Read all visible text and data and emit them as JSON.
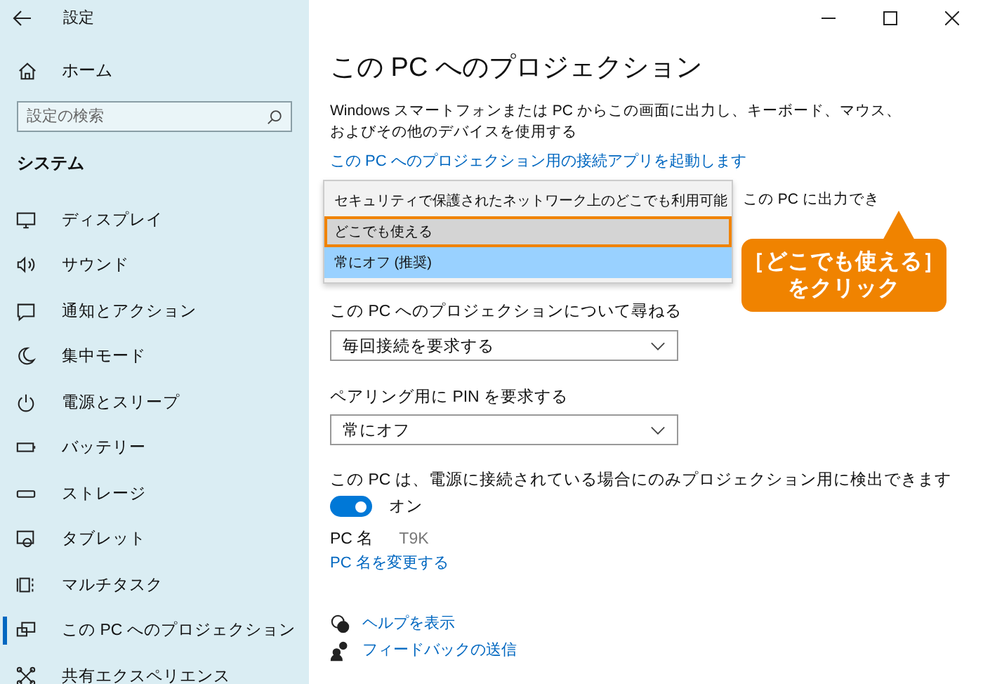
{
  "window": {
    "title": "設定"
  },
  "sidebar": {
    "home": "ホーム",
    "search": {
      "placeholder": "設定の検索"
    },
    "section": "システム",
    "items": [
      {
        "label": "ディスプレイ",
        "selected": false
      },
      {
        "label": "サウンド",
        "selected": false
      },
      {
        "label": "通知とアクション",
        "selected": false
      },
      {
        "label": "集中モード",
        "selected": false
      },
      {
        "label": "電源とスリープ",
        "selected": false
      },
      {
        "label": "バッテリー",
        "selected": false
      },
      {
        "label": "ストレージ",
        "selected": false
      },
      {
        "label": "タブレット",
        "selected": false
      },
      {
        "label": "マルチタスク",
        "selected": false
      },
      {
        "label": "この PC へのプロジェクション",
        "selected": true
      },
      {
        "label": "共有エクスペリエンス",
        "selected": false
      }
    ]
  },
  "page": {
    "title": "この PC へのプロジェクション",
    "description": "Windows スマートフォンまたは PC からこの画面に出力し、キーボード、マウス、およびその他のデバイスを使用する",
    "app_link": "この PC へのプロジェクション用の接続アプリを起動します",
    "covered_label": "この PC に出力でき",
    "dropdown_menu": [
      {
        "label": "セキュリティで保護されたネットワーク上のどこでも利用可能",
        "selected": false,
        "hovered": false,
        "annotated": false
      },
      {
        "label": "どこでも使える",
        "selected": false,
        "hovered": true,
        "annotated": true
      },
      {
        "label": "常にオフ (推奨)",
        "selected": true,
        "hovered": false,
        "annotated": false
      }
    ],
    "ask": {
      "label": "この PC へのプロジェクションについて尋ねる",
      "value": "毎回接続を要求する"
    },
    "pin": {
      "label": "ペアリング用に PIN を要求する",
      "value": "常にオフ"
    },
    "power_note": "この PC は、電源に接続されている場合にのみプロジェクション用に検出できます",
    "toggle": {
      "on": true,
      "label": "オン"
    },
    "pc_name": {
      "label": "PC 名",
      "value": "T9K"
    },
    "rename_link": "PC 名を変更する",
    "help_link": "ヘルプを表示",
    "feedback_link": "フィードバックの送信"
  },
  "callout": {
    "lines": [
      "［どこでも使える］",
      "をクリック"
    ]
  }
}
